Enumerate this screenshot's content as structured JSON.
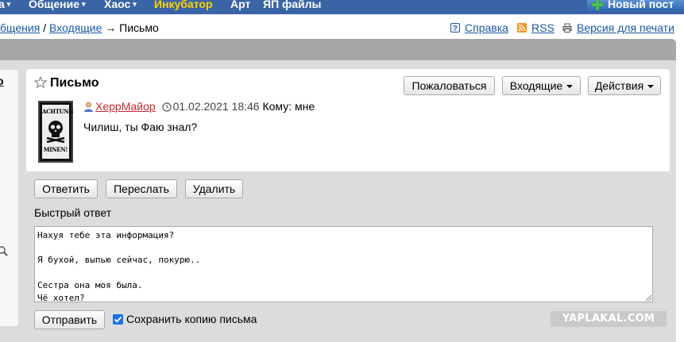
{
  "topnav": {
    "items": [
      {
        "label": "а",
        "caret": "▾"
      },
      {
        "label": "Общение",
        "caret": "▾"
      },
      {
        "label": "Хаос",
        "caret": "▾"
      },
      {
        "label": "Инкубатор"
      },
      {
        "label": "Арт"
      },
      {
        "label": "ЯП файлы"
      }
    ],
    "new_post": "Новый пост"
  },
  "breadcrumb": {
    "part1": "бщения",
    "sep": " / ",
    "part2": "Входящие",
    "arrow": " → ",
    "current": "Письмо"
  },
  "toplinks": {
    "help": "Справка",
    "rss": "RSS",
    "print": "Версия для печати"
  },
  "sidebar": {
    "letter": "о"
  },
  "message": {
    "title": "Письмо",
    "buttons": {
      "report": "Пожаловаться",
      "inbox": "Входящие",
      "actions": "Действия"
    },
    "avatar_text_top": "ACHTUNG",
    "avatar_text_bottom": "MINEN!",
    "author": "ХеррМайор",
    "date": "01.02.2021 18:46",
    "to_label": "Кому: мне",
    "body": "Чилиш, ты Фаю знал?"
  },
  "actions": {
    "reply": "Ответить",
    "forward": "Переслать",
    "delete": "Удалить"
  },
  "quick_reply": {
    "label": "Быстрый ответ",
    "text": "Нахуя тебе эта информация?\n\nЯ бухой, выпью сейчас, покурю..\n\nСестра она моя была.\nЧё хотел?",
    "send": "Отправить",
    "save_copy": "Сохранить копию письма",
    "save_checked": true
  },
  "watermark": "YAPLAKAL.COM",
  "colors": {
    "nav_bg": "#3b64a6",
    "incubator": "#ffd400",
    "link": "#1a5aa6",
    "author": "#c8282d",
    "checkbox": "#1a73e8"
  }
}
